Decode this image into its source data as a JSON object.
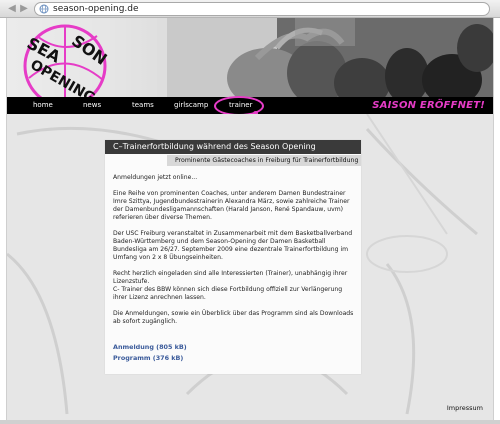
{
  "browser": {
    "url": "season-opening.de",
    "back_icon": "arrow-left-icon",
    "forward_icon": "arrow-right-icon",
    "site_icon": "globe-icon"
  },
  "logo": {
    "text_line1": "SEA SON",
    "text_line2": "OPENING",
    "accent_color": "#e63cc7"
  },
  "nav": {
    "items": [
      {
        "label": "home"
      },
      {
        "label": "news"
      },
      {
        "label": "teams"
      },
      {
        "label": "girlscamp"
      },
      {
        "label": "trainer"
      }
    ],
    "active": "trainer",
    "slogan": "SAISON ERÖFFNET!"
  },
  "article": {
    "title": "C–Trainerfortbildung während des Season Opening",
    "subtitle": "Prominente Gästecoaches in Freiburg für Trainerfortbildung",
    "paragraphs": [
      "Anmeldungen jetzt online...",
      "Eine Reihe von prominenten Coaches, unter anderem Damen Bundestrainer Imre Szittya, Jugendbundestrainerin Alexandra März, sowie zahlreiche Trainer der Damenbundesligamannschaften (Harald Janson, René Spandauw, uvm) referieren über diverse Themen.",
      "Der USC Freiburg veranstaltet in Zusammenarbeit mit dem Basketballverband Baden-Württemberg und dem Season-Opening der Damen Basketball Bundesliga am 26/27. September 2009 eine dezentrale Trainerfortbildung im Umfang von 2 x 8 Übungseinheiten.",
      "Recht herzlich eingeladen sind alle Interessierten (Trainer), unabhängig ihrer Lizenzstufe.\nC- Trainer des BBW können sich diese Fortbildung offiziell zur Verlängerung ihrer Lizenz anrechnen lassen.",
      "Die Anmeldungen, sowie ein Überblick über das Programm sind als Downloads ab sofort zugänglich."
    ],
    "downloads": [
      {
        "label": "Anmeldung (805 kB)"
      },
      {
        "label": "Programm (376 kB)"
      }
    ]
  },
  "footer": {
    "impressum": "Impressum"
  }
}
